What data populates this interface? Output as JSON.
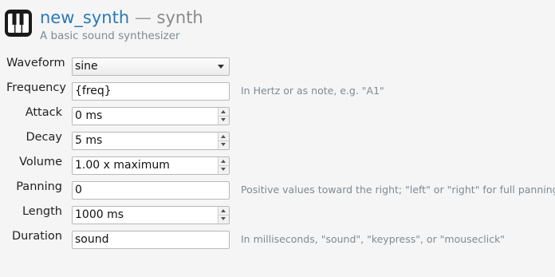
{
  "header": {
    "icon": "piano-keys-icon",
    "name": "new_synth",
    "separator": "—",
    "type": "synth",
    "description": "A basic sound synthesizer"
  },
  "fields": {
    "waveform": {
      "label": "Waveform",
      "value": "sine"
    },
    "frequency": {
      "label": "Frequency",
      "value": "{freq}",
      "hint": "In Hertz or as note, e.g. \"A1\""
    },
    "attack": {
      "label": "Attack",
      "value": "0 ms"
    },
    "decay": {
      "label": "Decay",
      "value": "5 ms"
    },
    "volume": {
      "label": "Volume",
      "value": "1.00 x maximum"
    },
    "panning": {
      "label": "Panning",
      "value": "0",
      "hint": "Positive values toward the right; \"left\" or \"right\" for full panning"
    },
    "length": {
      "label": "Length",
      "value": "1000 ms"
    },
    "duration": {
      "label": "Duration",
      "value": "sound",
      "hint": "In milliseconds, \"sound\", \"keypress\", or \"mouseclick\""
    }
  }
}
